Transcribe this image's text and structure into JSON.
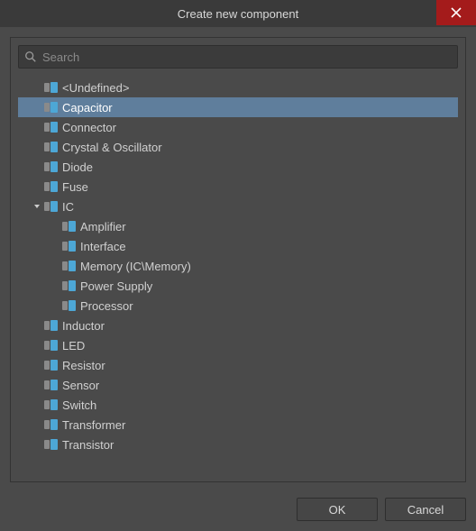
{
  "window": {
    "title": "Create new component"
  },
  "search": {
    "placeholder": "Search",
    "value": ""
  },
  "tree": [
    {
      "label": "<Undefined>",
      "depth": 0,
      "expanded": null,
      "selected": false
    },
    {
      "label": "Capacitor",
      "depth": 0,
      "expanded": null,
      "selected": true
    },
    {
      "label": "Connector",
      "depth": 0,
      "expanded": null,
      "selected": false
    },
    {
      "label": "Crystal & Oscillator",
      "depth": 0,
      "expanded": null,
      "selected": false
    },
    {
      "label": "Diode",
      "depth": 0,
      "expanded": null,
      "selected": false
    },
    {
      "label": "Fuse",
      "depth": 0,
      "expanded": null,
      "selected": false
    },
    {
      "label": "IC",
      "depth": 0,
      "expanded": true,
      "selected": false
    },
    {
      "label": "Amplifier",
      "depth": 1,
      "expanded": null,
      "selected": false
    },
    {
      "label": "Interface",
      "depth": 1,
      "expanded": null,
      "selected": false
    },
    {
      "label": "Memory (IC\\Memory)",
      "depth": 1,
      "expanded": null,
      "selected": false
    },
    {
      "label": "Power Supply",
      "depth": 1,
      "expanded": null,
      "selected": false
    },
    {
      "label": "Processor",
      "depth": 1,
      "expanded": null,
      "selected": false
    },
    {
      "label": "Inductor",
      "depth": 0,
      "expanded": null,
      "selected": false
    },
    {
      "label": "LED",
      "depth": 0,
      "expanded": null,
      "selected": false
    },
    {
      "label": "Resistor",
      "depth": 0,
      "expanded": null,
      "selected": false
    },
    {
      "label": "Sensor",
      "depth": 0,
      "expanded": null,
      "selected": false
    },
    {
      "label": "Switch",
      "depth": 0,
      "expanded": null,
      "selected": false
    },
    {
      "label": "Transformer",
      "depth": 0,
      "expanded": null,
      "selected": false
    },
    {
      "label": "Transistor",
      "depth": 0,
      "expanded": null,
      "selected": false
    }
  ],
  "buttons": {
    "ok": "OK",
    "cancel": "Cancel"
  }
}
